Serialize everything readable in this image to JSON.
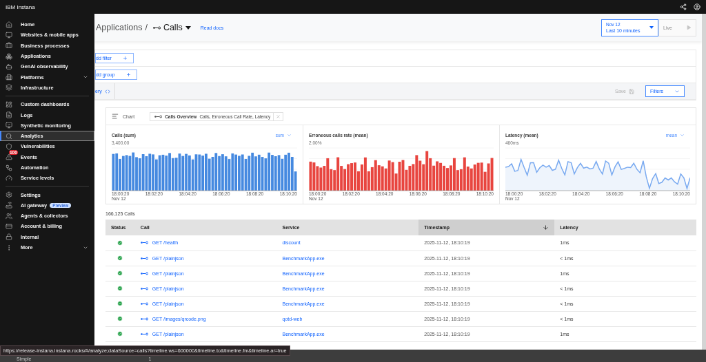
{
  "top_bar": {
    "brand": "IBM Instana"
  },
  "sidebar": {
    "sections": [
      {
        "items": [
          {
            "label": "Home",
            "selected": false,
            "kind": "link"
          },
          {
            "label": "Websites & mobile apps",
            "selected": false,
            "kind": "link"
          },
          {
            "label": "Business processes",
            "selected": false,
            "kind": "link"
          },
          {
            "label": "Applications",
            "selected": false,
            "kind": "link"
          },
          {
            "label": "GenAI observability",
            "selected": false,
            "kind": "link"
          },
          {
            "label": "Platforms",
            "selected": false,
            "kind": "menu"
          },
          {
            "label": "Infrastructure",
            "selected": false,
            "kind": "link"
          }
        ]
      },
      {
        "items": [
          {
            "label": "Custom dashboards",
            "selected": false,
            "kind": "link"
          },
          {
            "label": "Logs",
            "selected": false,
            "kind": "link"
          },
          {
            "label": "Synthetic monitoring",
            "selected": false,
            "kind": "link"
          },
          {
            "label": "Analytics",
            "selected": true,
            "kind": "link"
          },
          {
            "label": "Vulnerabilities",
            "selected": false,
            "kind": "link"
          },
          {
            "label": "Events",
            "selected": false,
            "kind": "link",
            "badge": "100"
          },
          {
            "label": "Automation",
            "selected": false,
            "kind": "link"
          },
          {
            "label": "Service levels",
            "selected": false,
            "kind": "link"
          }
        ]
      },
      {
        "items": [
          {
            "label": "Settings",
            "selected": false,
            "kind": "link"
          },
          {
            "label": "AI gateway",
            "selected": false,
            "kind": "link",
            "tag": "Preview"
          },
          {
            "label": "Agents & collectors",
            "selected": false,
            "kind": "link"
          },
          {
            "label": "Account & billing",
            "selected": false,
            "kind": "link"
          },
          {
            "label": "Internal",
            "selected": false,
            "kind": "link"
          },
          {
            "label": "More",
            "selected": false,
            "kind": "menu"
          }
        ]
      }
    ]
  },
  "header": {
    "breadcrumb_parent": "Applications",
    "separator": "/",
    "title": "Calls",
    "docs_link": "Read docs",
    "time_range": {
      "date": "Nov 12",
      "range": "Last 10 minutes"
    },
    "live_button": {
      "label": "Live",
      "disabled": true
    }
  },
  "filters": {
    "add_filter": "dd filter",
    "add_group": "dd group",
    "query": "ery",
    "save": {
      "label": "Save",
      "disabled": true
    },
    "filters_button": "Filters"
  },
  "chart_card": {
    "title": "Chart",
    "selection": {
      "name": "Calls Overview",
      "detail": "Calls, Erroneous Call Rate, Latency"
    },
    "panels": [
      {
        "kind": "bar",
        "title": "Calls (sum)",
        "aggregation": "sum",
        "top_tick": "3,400.00",
        "color": "#4589e0",
        "x_ticks": [
          "18:00:20",
          "18:02:20",
          "18:04:20",
          "18:06:20",
          "18:08:20",
          "18:10:20"
        ],
        "date": "Nov 12"
      },
      {
        "kind": "bar",
        "title": "Erroneous calls rate (mean)",
        "top_tick": "2.00%",
        "color": "#e8453f",
        "x_ticks": [
          "18:00:20",
          "18:02:20",
          "18:04:20",
          "18:06:20",
          "18:08:20",
          "18:10:20"
        ],
        "date": "Nov 12"
      },
      {
        "kind": "line",
        "title": "Latency (mean)",
        "aggregation": "mean",
        "top_tick": "460ms",
        "color": "#78a9f0",
        "x_ticks": [
          "18:00:20",
          "18:02:20",
          "18:04:20",
          "18:06:20",
          "18:08:20",
          "18:10:20"
        ],
        "date": "Nov 12"
      }
    ]
  },
  "results_count": "166,125 Calls",
  "table": {
    "columns": [
      {
        "label": "Status",
        "sorted": false
      },
      {
        "label": "Call",
        "sorted": false
      },
      {
        "label": "Service",
        "sorted": false
      },
      {
        "label": "Timestamp",
        "sorted": true
      },
      {
        "label": "Latency",
        "sorted": false
      }
    ],
    "rows": [
      {
        "success": true,
        "call": "GET /health",
        "service": "discount",
        "timestamp": "2025-11-12, 18:10:19",
        "latency": "1ms"
      },
      {
        "success": true,
        "call": "GET /plainjson",
        "service": "BenchmarkApp.exe",
        "timestamp": "2025-11-12, 18:10:19",
        "latency": "< 1ms"
      },
      {
        "success": true,
        "call": "GET /plainjson",
        "service": "BenchmarkApp.exe",
        "timestamp": "2025-11-12, 18:10:19",
        "latency": "1ms"
      },
      {
        "success": true,
        "call": "GET /plainjson",
        "service": "BenchmarkApp.exe",
        "timestamp": "2025-11-12, 18:10:19",
        "latency": "< 1ms"
      },
      {
        "success": true,
        "call": "GET /plainjson",
        "service": "BenchmarkApp.exe",
        "timestamp": "2025-11-12, 18:10:19",
        "latency": "< 1ms"
      },
      {
        "success": true,
        "call": "GET /images/qrcode.png",
        "service": "qotd-web",
        "timestamp": "2025-11-12, 18:10:19",
        "latency": "< 1ms"
      },
      {
        "success": true,
        "call": "GET /plainjson",
        "service": "BenchmarkApp.exe",
        "timestamp": "2025-11-12, 18:10:19",
        "latency": "1ms"
      }
    ]
  },
  "status_bar": {
    "mode": "Simple",
    "page": "1"
  },
  "link_preview": "https://release-instana.instana.rocks/#/analyze;dataSource=calls?timeline.ws=600000&timeline.to&timeline.fm&timeline.ar=true"
}
